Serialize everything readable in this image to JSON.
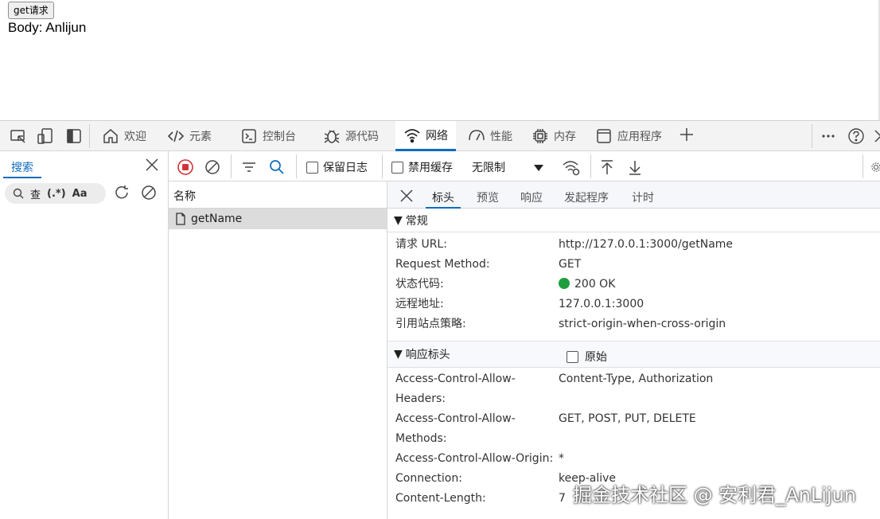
{
  "page": {
    "button_label": "get请求",
    "body_text": "Body: Anlijun"
  },
  "devtools": {
    "tabs": [
      {
        "label": "欢迎",
        "icon": "home-icon"
      },
      {
        "label": "元素",
        "icon": "code-icon"
      },
      {
        "label": "控制台",
        "icon": "console-icon"
      },
      {
        "label": "源代码",
        "icon": "bug-icon"
      },
      {
        "label": "网络",
        "icon": "wifi-icon",
        "active": true
      },
      {
        "label": "性能",
        "icon": "gauge-icon"
      },
      {
        "label": "内存",
        "icon": "chip-icon"
      },
      {
        "label": "应用程序",
        "icon": "window-icon"
      }
    ],
    "search": {
      "tab_label": "搜索",
      "box_text": "查",
      "regex_label": "(.*)",
      "case_label": "Aa"
    },
    "network_toolbar": {
      "preserve_log": "保留日志",
      "disable_cache": "禁用缓存",
      "throttling": "无限制"
    },
    "request_list": {
      "header": "名称",
      "rows": [
        "getName"
      ]
    },
    "detail": {
      "tabs": [
        "标头",
        "预览",
        "响应",
        "发起程序",
        "计时"
      ],
      "general": {
        "title": "常规",
        "rows": [
          {
            "k": "请求 URL:",
            "v": "http://127.0.0.1:3000/getName"
          },
          {
            "k": "Request Method:",
            "v": "GET"
          },
          {
            "k": "状态代码:",
            "v": "200 OK"
          },
          {
            "k": "远程地址:",
            "v": "127.0.0.1:3000"
          },
          {
            "k": "引用站点策略:",
            "v": "strict-origin-when-cross-origin"
          }
        ]
      },
      "response_headers": {
        "title": "响应标头",
        "raw_label": "原始",
        "rows": [
          {
            "k": "Access-Control-Allow-",
            "v": "Content-Type, Authorization"
          },
          {
            "k": "Headers:",
            "v": ""
          },
          {
            "k": "Access-Control-Allow-",
            "v": "GET, POST, PUT, DELETE"
          },
          {
            "k": "Methods:",
            "v": ""
          },
          {
            "k": "Access-Control-Allow-Origin:",
            "v": "*"
          },
          {
            "k": "Connection:",
            "v": "keep-alive"
          },
          {
            "k": "Content-Length:",
            "v": "7"
          }
        ]
      }
    }
  },
  "watermark": "掘金技术社区 @ 安利君_AnLijun",
  "colors": {
    "accent": "#0f6cbd",
    "status_ok": "#1e9e3f"
  }
}
